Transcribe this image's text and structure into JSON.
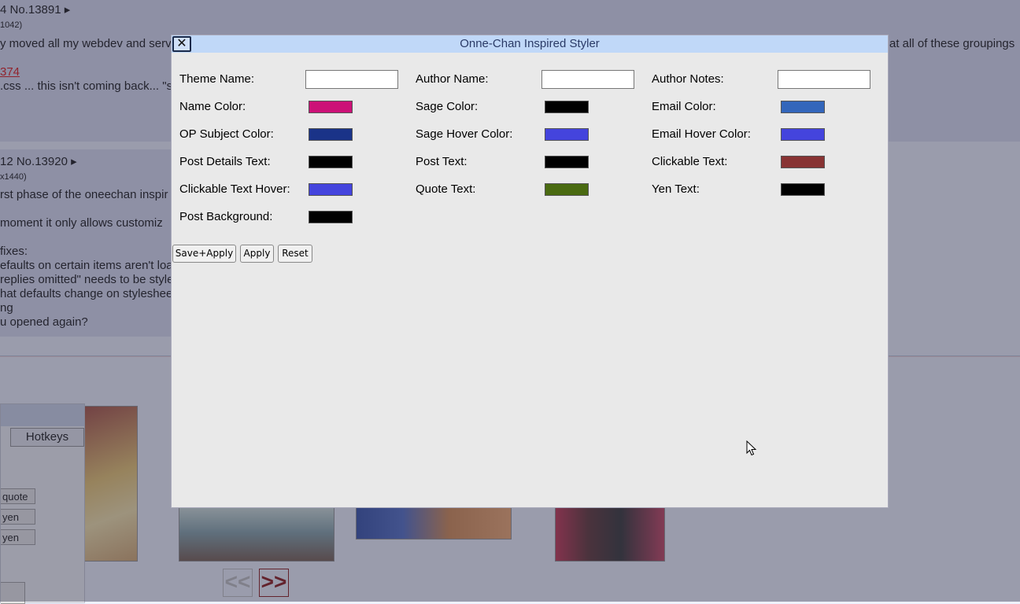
{
  "background": {
    "post1": {
      "header": "4 No.13891 ▸",
      "sub": "1042)",
      "line1": "y moved all my webdev and serv",
      "line1_right": "at all of these groupings",
      "link": "374",
      "line2": ".css ... this isn't coming back... \"s"
    },
    "post2": {
      "header": "12 No.13920 ▸",
      "sub": "x1440)",
      "lines": [
        "rst phase of the oneechan inspir",
        "moment it only allows customiz",
        "fixes:",
        "efaults on certain items aren't loa",
        "replies omitted\" needs to be style",
        "hat defaults change on styleshee",
        "ng",
        "u opened again?"
      ]
    },
    "side_panel": {
      "hotkeys": "Hotkeys",
      "items": [
        "quote",
        "yen",
        "yen"
      ]
    },
    "pager": {
      "prev": "<<",
      "next": ">>"
    }
  },
  "modal": {
    "title": "Onne-Chan Inspired Styler",
    "close_label": "✕",
    "fields": {
      "theme_name": {
        "label": "Theme Name:",
        "value": ""
      },
      "author_name": {
        "label": "Author Name:",
        "value": ""
      },
      "author_notes": {
        "label": "Author Notes:",
        "value": ""
      },
      "name_color": {
        "label": "Name Color:",
        "color": "#cc1177"
      },
      "sage_color": {
        "label": "Sage Color:",
        "color": "#000000"
      },
      "email_color": {
        "label": "Email Color:",
        "color": "#3366bb"
      },
      "op_subject_color": {
        "label": "OP Subject Color:",
        "color": "#1a3388"
      },
      "sage_hover_color": {
        "label": "Sage Hover Color:",
        "color": "#4444dd"
      },
      "email_hover_color": {
        "label": "Email Hover Color:",
        "color": "#4444dd"
      },
      "post_details_text": {
        "label": "Post Details Text:",
        "color": "#000000"
      },
      "post_text": {
        "label": "Post Text:",
        "color": "#000000"
      },
      "clickable_text": {
        "label": "Clickable Text:",
        "color": "#883333"
      },
      "clickable_text_hover": {
        "label": "Clickable Text Hover:",
        "color": "#4444dd"
      },
      "quote_text": {
        "label": "Quote Text:",
        "color": "#4a6a11"
      },
      "yen_text": {
        "label": "Yen Text:",
        "color": "#000000"
      },
      "post_background": {
        "label": "Post Background:",
        "color": "#000000"
      }
    },
    "buttons": {
      "save_apply": "Save+Apply",
      "apply": "Apply",
      "reset": "Reset"
    }
  }
}
